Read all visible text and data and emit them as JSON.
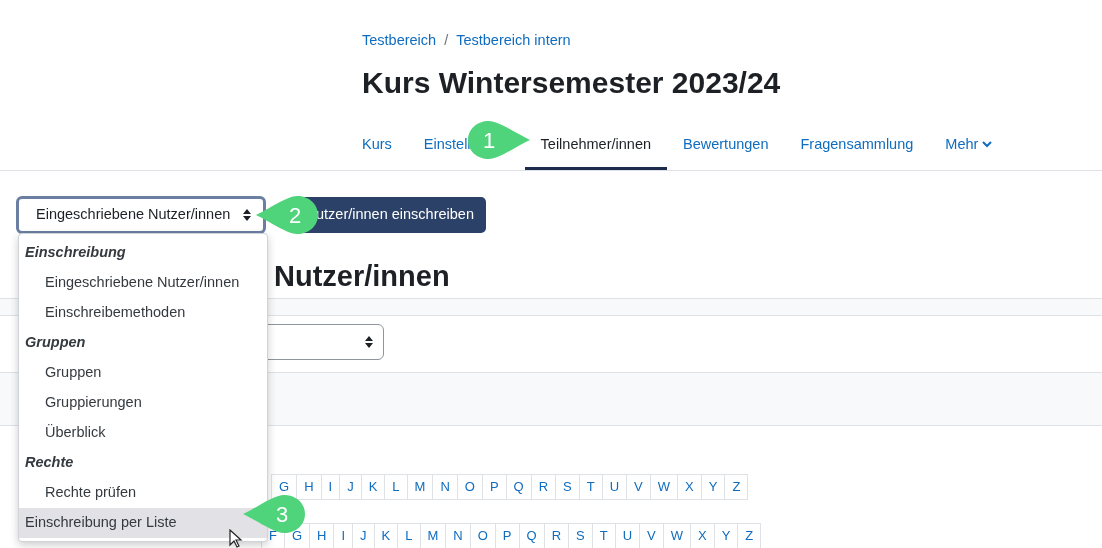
{
  "breadcrumb": {
    "items": [
      {
        "label": "Testbereich"
      },
      {
        "label": "Testbereich intern"
      }
    ],
    "separator": "/"
  },
  "title": "Kurs Wintersemester 2023/24",
  "tabs": [
    {
      "label": "Kurs",
      "selected": false,
      "has_caret": false
    },
    {
      "label": "Einstell",
      "selected": false,
      "has_caret": false
    },
    {
      "label": "Teilnehmer/innen",
      "selected": true,
      "has_caret": false
    },
    {
      "label": "Bewertungen",
      "selected": false,
      "has_caret": false
    },
    {
      "label": "Fragensammlung",
      "selected": false,
      "has_caret": false
    },
    {
      "label": "Mehr",
      "selected": false,
      "has_caret": true
    }
  ],
  "page_select": {
    "value": "Eingeschriebene Nutzer/innen",
    "expanded": true
  },
  "enrol_button": {
    "label": "utzer/innen einschreiben"
  },
  "heading": "Nutzer/innen",
  "menu": [
    {
      "kind": "heading",
      "label": "Einschreibung"
    },
    {
      "kind": "option",
      "label": "Eingeschriebene Nutzer/innen",
      "selected": false
    },
    {
      "kind": "option",
      "label": "Einschreibemethoden",
      "selected": false
    },
    {
      "kind": "heading",
      "label": "Gruppen"
    },
    {
      "kind": "option",
      "label": "Gruppen",
      "selected": false
    },
    {
      "kind": "option",
      "label": "Gruppierungen",
      "selected": false
    },
    {
      "kind": "option",
      "label": "Überblick",
      "selected": false
    },
    {
      "kind": "heading",
      "label": "Rechte"
    },
    {
      "kind": "option",
      "label": "Rechte prüfen",
      "selected": false
    },
    {
      "kind": "plain",
      "label": "Einschreibung per Liste",
      "selected": true
    }
  ],
  "initials_rows": [
    {
      "letters": [
        "G",
        "H",
        "I",
        "J",
        "K",
        "L",
        "M",
        "N",
        "O",
        "P",
        "Q",
        "R",
        "S",
        "T",
        "U",
        "V",
        "W",
        "X",
        "Y",
        "Z"
      ]
    },
    {
      "letters": [
        "F",
        "G",
        "H",
        "I",
        "J",
        "K",
        "L",
        "M",
        "N",
        "O",
        "P",
        "Q",
        "R",
        "S",
        "T",
        "U",
        "V",
        "W",
        "X",
        "Y",
        "Z"
      ]
    }
  ],
  "callouts": [
    {
      "number": "1"
    },
    {
      "number": "2"
    },
    {
      "number": "3"
    }
  ]
}
